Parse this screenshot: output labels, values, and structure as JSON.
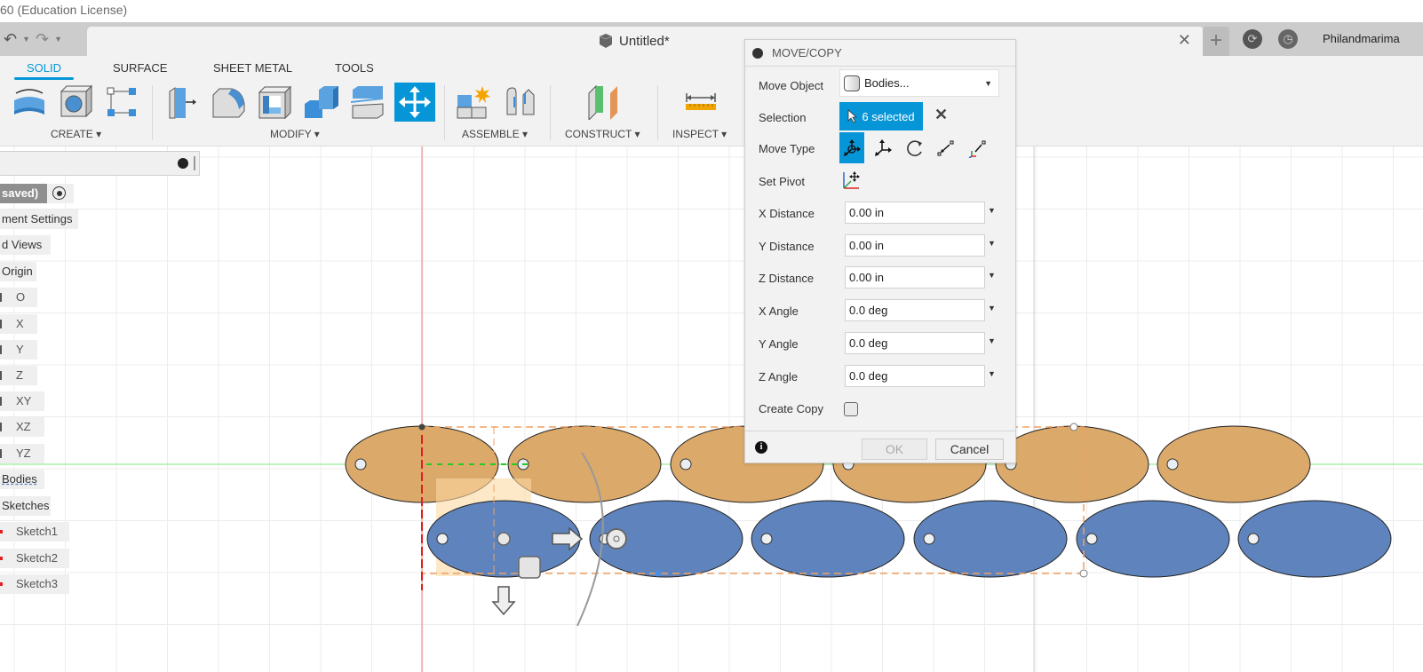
{
  "window": {
    "title_fragment": "60 (Education License)",
    "document_title": "Untitled*",
    "user": "Philandmarima"
  },
  "quick_access": {
    "undo_icon": "undo-icon",
    "redo_icon": "redo-icon"
  },
  "ribbon": {
    "tabs": [
      {
        "label": "SOLID",
        "active": true
      },
      {
        "label": "SURFACE",
        "active": false
      },
      {
        "label": "SHEET METAL",
        "active": false
      },
      {
        "label": "TOOLS",
        "active": false
      }
    ],
    "groups": [
      {
        "label": "CREATE ▾",
        "tools": [
          "revolve-icon",
          "hole-icon",
          "pattern-icon"
        ]
      },
      {
        "label": "MODIFY ▾",
        "tools": [
          "press-pull-icon",
          "fillet-icon",
          "shell-icon",
          "combine-icon",
          "split-body-icon",
          "move-copy-icon"
        ]
      },
      {
        "label": "ASSEMBLE ▾",
        "tools": [
          "new-component-icon",
          "joint-icon"
        ]
      },
      {
        "label": "CONSTRUCT ▾",
        "tools": [
          "offset-plane-icon"
        ]
      },
      {
        "label": "INSPECT ▾",
        "tools": [
          "measure-icon"
        ]
      }
    ],
    "selected_tool": "move-copy-icon"
  },
  "browser": {
    "root_label": "saved)",
    "items": [
      {
        "label": "ment Settings",
        "level": 0
      },
      {
        "label": "d Views",
        "level": 0
      },
      {
        "label": "Origin",
        "level": 0
      },
      {
        "label": "O",
        "level": 1
      },
      {
        "label": "X",
        "level": 1
      },
      {
        "label": "Y",
        "level": 1
      },
      {
        "label": "Z",
        "level": 1
      },
      {
        "label": "XY",
        "level": 1
      },
      {
        "label": "XZ",
        "level": 1
      },
      {
        "label": "YZ",
        "level": 1
      },
      {
        "label": "Bodies",
        "level": 0
      },
      {
        "label": "Sketches",
        "level": 0
      },
      {
        "label": "Sketch1",
        "level": 1
      },
      {
        "label": "Sketch2",
        "level": 1
      },
      {
        "label": "Sketch3",
        "level": 1
      }
    ]
  },
  "dialog": {
    "title": "MOVE/COPY",
    "move_object_label": "Move Object",
    "move_object_value": "Bodies...",
    "selection_label": "Selection",
    "selection_value": "6 selected",
    "move_type_label": "Move Type",
    "move_types": [
      "free-move-icon",
      "translate-icon",
      "rotate-icon",
      "point-to-point-icon",
      "point-to-position-icon"
    ],
    "move_type_selected": "free-move-icon",
    "set_pivot_label": "Set Pivot",
    "fields": [
      {
        "label": "X Distance",
        "value": "0.00 in"
      },
      {
        "label": "Y Distance",
        "value": "0.00 in"
      },
      {
        "label": "Z Distance",
        "value": "0.00 in"
      },
      {
        "label": "X Angle",
        "value": "0.0 deg"
      },
      {
        "label": "Y Angle",
        "value": "0.0 deg"
      },
      {
        "label": "Z Angle",
        "value": "0.0 deg"
      }
    ],
    "create_copy_label": "Create Copy",
    "create_copy_checked": false,
    "ok_label": "OK",
    "cancel_label": "Cancel"
  },
  "canvas": {
    "tan_body_count": 6,
    "blue_body_count": 6,
    "colors": {
      "tan_body": "#dba96a",
      "blue_body": "#5f84bd",
      "accent": "#0696d7",
      "selection_box": "#f0a060"
    }
  }
}
